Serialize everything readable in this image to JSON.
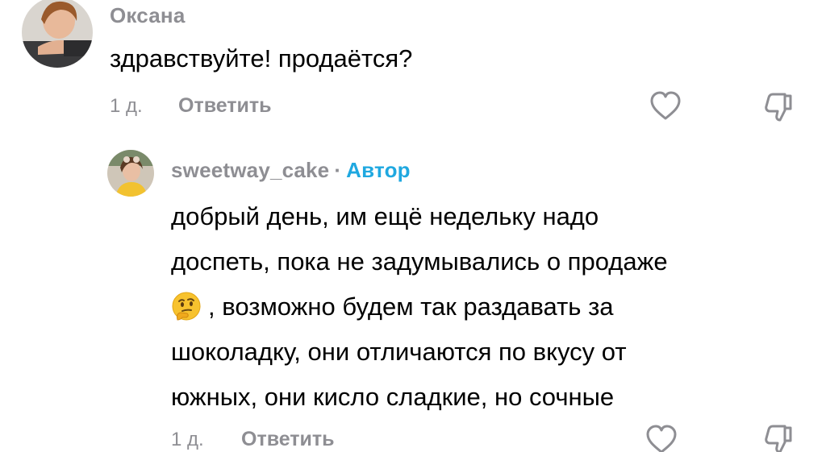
{
  "comments": [
    {
      "username": "Оксана",
      "text": "здравствуйте! продаётся?",
      "time": "1 д.",
      "reply_label": "Ответить",
      "like_icon": "heart-icon",
      "dislike_icon": "thumbs-down-icon"
    },
    {
      "username": "sweetway_cake",
      "separator": "·",
      "badge": "Автор",
      "text_lines": [
        "добрый день, им ещё недельку надо",
        "доспеть, пока не задумывались о продаже",
        ", возможно будем так раздавать за",
        "шоколадку, они отличаются по вкусу от",
        "южных, они кисло сладкие, но сочные"
      ],
      "emoji": "thinking-face",
      "time": "1 д.",
      "reply_label": "Ответить",
      "like_icon": "heart-icon",
      "dislike_icon": "thumbs-down-icon"
    }
  ],
  "colors": {
    "meta_gray": "#8e8e93",
    "author_blue": "#1fa8e0",
    "text": "#000000"
  }
}
